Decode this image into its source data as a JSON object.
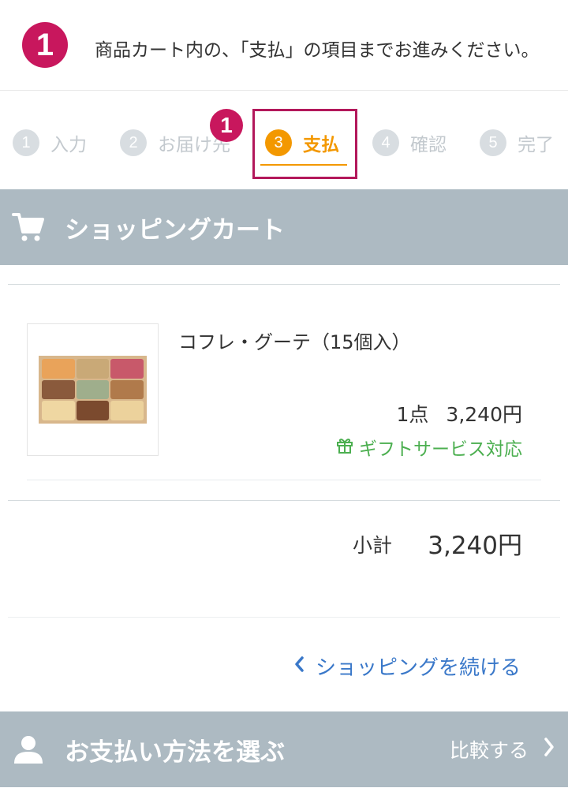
{
  "instruction": {
    "badge": "1",
    "text": "商品カート内の、「支払」の項目までお進みください。"
  },
  "steps": {
    "badge": "1",
    "items": [
      {
        "num": "1",
        "label": "入力"
      },
      {
        "num": "2",
        "label": "お届け先"
      },
      {
        "num": "3",
        "label": "支払"
      },
      {
        "num": "4",
        "label": "確認"
      },
      {
        "num": "5",
        "label": "完了"
      }
    ],
    "active_index": 2
  },
  "cart": {
    "title": "ショッピングカート",
    "icon": "cart-icon",
    "item": {
      "name": "コフレ・グーテ（15個入）",
      "quantity": "1点",
      "price": "3,240円",
      "gift_label": "ギフトサービス対応",
      "gift_icon": "gift-icon"
    },
    "subtotal_label": "小計",
    "subtotal_value": "3,240円",
    "continue_label": "ショッピングを続ける"
  },
  "payment": {
    "title": "お支払い方法を選ぶ",
    "icon": "person-icon",
    "compare_label": "比較する"
  },
  "colors": {
    "accent_pink": "#c8175d",
    "step_active": "#f39800",
    "header_gray": "#adbac2",
    "link_blue": "#3a78c9",
    "gift_green": "#4caf50"
  }
}
